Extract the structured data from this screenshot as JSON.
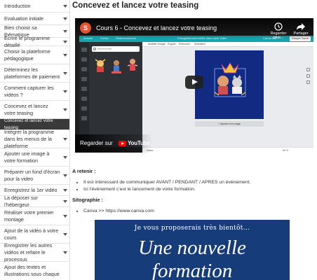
{
  "sidebar": {
    "items": [
      {
        "label": "Introduction",
        "has_caret": true
      },
      {
        "label": "Evaluation initiale",
        "has_caret": true
      },
      {
        "label": "Bien choisir sa thématique",
        "has_caret": true
      },
      {
        "label": "Écrire le programme détaillé",
        "has_caret": true
      },
      {
        "label": "Choisir la plateforme pédagogique",
        "has_caret": true
      },
      {
        "label": "Déterminez les plateformes de paiement",
        "has_caret": true
      },
      {
        "label": "Comment capturer les vidéos ?",
        "has_caret": true
      },
      {
        "label": "Concevez et lancez votre teasing",
        "has_caret": true
      },
      {
        "label": "Concevez et lancez votre teasing",
        "has_caret": false,
        "active": true
      },
      {
        "label": "Intégrer la programme dans les menus de la plateforme",
        "has_caret": true
      },
      {
        "label": "Ajouter une image à votre formation",
        "has_caret": true
      },
      {
        "label": "Préparer un fond d'écran pour la video",
        "has_caret": true
      },
      {
        "label": "Enregistrez la 1er vidéo",
        "has_caret": true
      },
      {
        "label": "La déposer sur l'hébergeur",
        "has_caret": true
      },
      {
        "label": "Réaliser votre premier montage",
        "has_caret": true
      },
      {
        "label": "Ajout de la vidéo à votre cours",
        "has_caret": true
      },
      {
        "label": "Enregistrer les autres vidéos et refaire le processus",
        "has_caret": true
      },
      {
        "label": "Ajout des textes et illustrations sous chaque",
        "has_caret": false
      }
    ]
  },
  "main": {
    "title": "Concevez et lancez votre teasing",
    "video": {
      "channel_letter": "S",
      "title": "Cours 6 - Concevez et lancez votre teasing",
      "actions": [
        {
          "label": "Regarder plus...",
          "icon": "clock-icon"
        },
        {
          "label": "Partager",
          "icon": "share-icon"
        }
      ],
      "watch_on": "Regarder sur",
      "youtube": "YouTube",
      "canva": {
        "top_items": [
          "Accueil",
          "Fichier",
          "Redimensionner",
          "Enregistrement 6dd54 dans votre Vidéo",
          "Canva Pro"
        ],
        "share_button": "Essayer Canva Pro",
        "sub_items": [
          "Modifier l'image",
          "Rogner",
          "Retourner",
          "Animation"
        ],
        "search_placeholder": "Rechercher",
        "add_page": "+ Ajouter une page",
        "bottom": [
          "Notes",
          "60 %"
        ]
      }
    },
    "sections": [
      {
        "heading": "A retenir :",
        "bullets": [
          "Il est intéressant de communiquer AVANT / PENDANT / APRES un évènement.",
          "Ici l'évènement c'est le lancement de votre formation."
        ]
      },
      {
        "heading": "Sitographie :",
        "bullets": [
          "Canva >> https://www.canva.com"
        ]
      }
    ],
    "promo": {
      "line1": "Je vous proposerais très bientôt...",
      "line2": "Une nouvelle",
      "line3": "formation"
    }
  }
}
